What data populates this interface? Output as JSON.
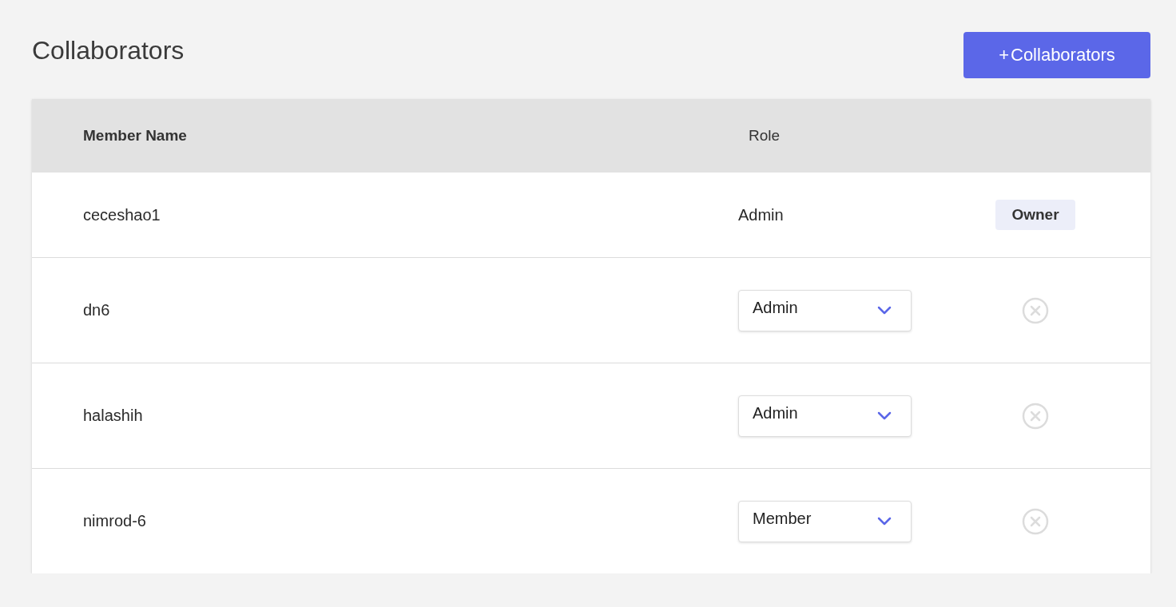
{
  "title": "Collaborators",
  "add_button": {
    "icon": "+",
    "label": "Collaborators"
  },
  "table": {
    "columns": [
      "Member Name",
      "Role"
    ],
    "rows": [
      {
        "name": "ceceshao1",
        "role": {
          "kind": "text",
          "value": "Admin"
        },
        "action": {
          "kind": "badge",
          "label": "Owner"
        }
      },
      {
        "name": "dn6",
        "role": {
          "kind": "select",
          "value": "Admin"
        },
        "action": {
          "kind": "remove"
        }
      },
      {
        "name": "halashih",
        "role": {
          "kind": "select",
          "value": "Admin"
        },
        "action": {
          "kind": "remove"
        }
      },
      {
        "name": "nimrod-6",
        "role": {
          "kind": "select",
          "value": "Member"
        },
        "action": {
          "kind": "remove"
        }
      }
    ]
  }
}
